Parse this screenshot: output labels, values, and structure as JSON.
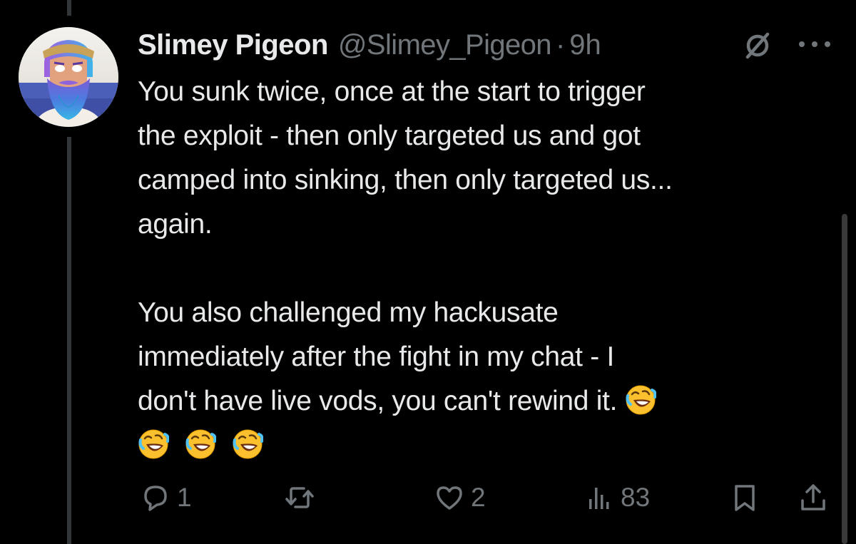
{
  "tweet": {
    "author": {
      "display_name": "Slimey Pigeon",
      "handle": "@Slimey_Pigeon",
      "separator": "·",
      "time": "9h"
    },
    "text": {
      "paragraph_1": "You sunk twice, once at the start to trigger\nthe exploit - then only targeted us and got\ncamped into sinking, then only targeted us...\nagain.",
      "paragraph_2": "You also challenged my hackusate\nimmediately after the fight in my chat - I\ndon't have live vods, you can't rewind it. ",
      "emoji_name": "rolling-on-the-floor-laughing"
    },
    "icons": {
      "grok": "grok-icon",
      "more": "more-icon"
    }
  },
  "actions": {
    "reply_count": "1",
    "repost_count": "",
    "like_count": "2",
    "views_count": "83"
  },
  "colors": {
    "background": "#000000",
    "text_primary": "#e7e9ea",
    "text_secondary": "#71767b",
    "thread_line": "#333639"
  }
}
